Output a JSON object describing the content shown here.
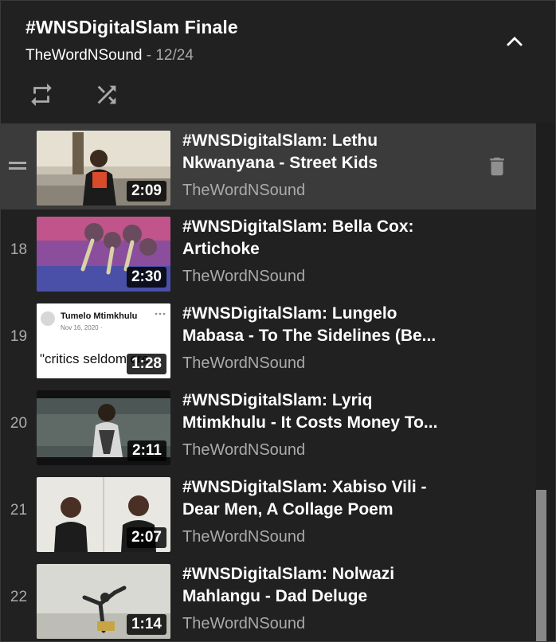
{
  "playlist": {
    "title": "#WNSDigitalSlam Finale",
    "channel": "TheWordNSound",
    "separator": " - ",
    "position": "12/24"
  },
  "controls": {
    "collapse_icon": "chevron-up-icon",
    "loop_icon": "loop-icon",
    "shuffle_icon": "shuffle-icon"
  },
  "items": [
    {
      "index": "",
      "title": "#WNSDigitalSlam: Lethu Nkwanyana - Street Kids",
      "channel": "TheWordNSound",
      "duration": "2:09",
      "selected": true
    },
    {
      "index": "18",
      "title": "#WNSDigitalSlam: Bella Cox: Artichoke",
      "channel": "TheWordNSound",
      "duration": "2:30"
    },
    {
      "index": "19",
      "title": "#WNSDigitalSlam: Lungelo Mabasa - To The Sidelines (Be...",
      "channel": "TheWordNSound",
      "duration": "1:28",
      "thumb_name": "Tumelo Mtimkhulu",
      "thumb_date": "Nov 16, 2020 · ",
      "thumb_quote": "\"critics seldom cre"
    },
    {
      "index": "20",
      "title": "#WNSDigitalSlam: Lyriq Mtimkhulu - It Costs Money To...",
      "channel": "TheWordNSound",
      "duration": "2:11"
    },
    {
      "index": "21",
      "title": "#WNSDigitalSlam: Xabiso Vili - Dear Men, A Collage Poem",
      "channel": "TheWordNSound",
      "duration": "2:07"
    },
    {
      "index": "22",
      "title": "#WNSDigitalSlam: Nolwazi Mahlangu - Dad Deluge",
      "channel": "TheWordNSound",
      "duration": "1:14"
    }
  ]
}
